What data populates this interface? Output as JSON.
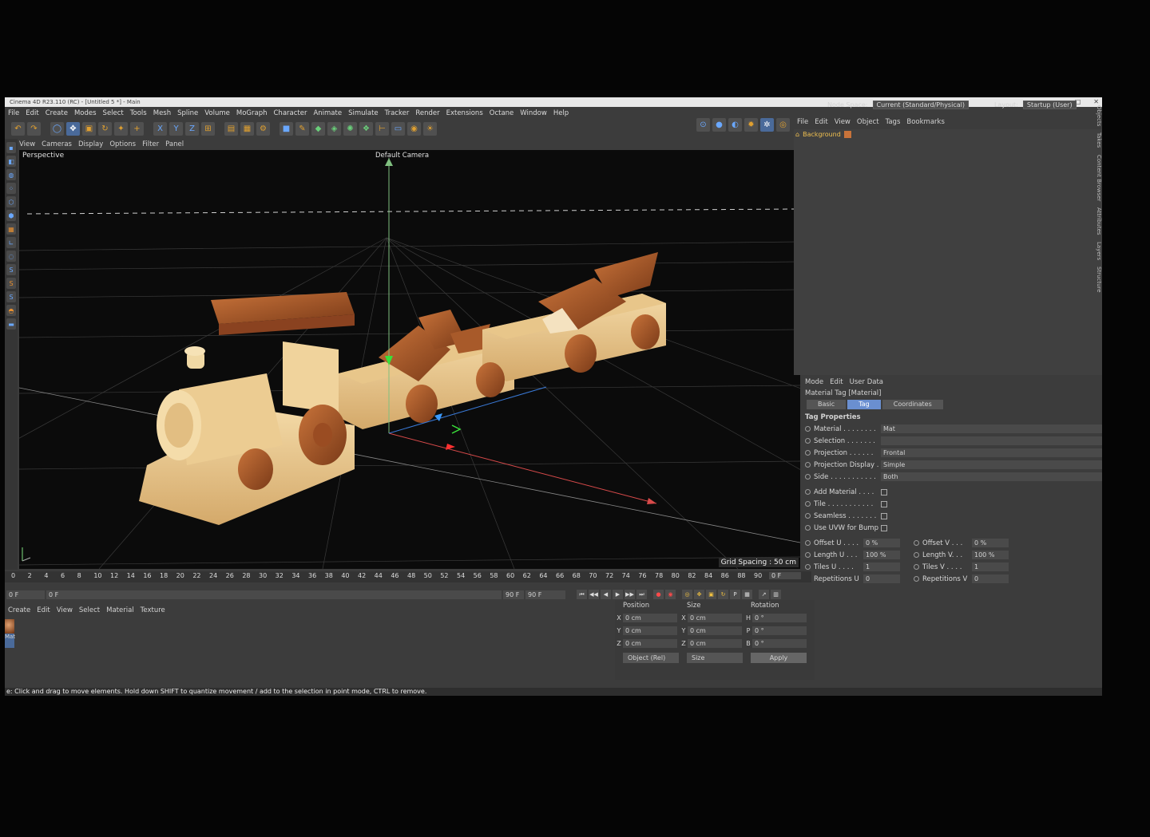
{
  "window": {
    "title": "Cinema 4D R23.110 (RC) - [Untitled 5 *] - Main"
  },
  "menu": [
    "File",
    "Edit",
    "Create",
    "Modes",
    "Select",
    "Tools",
    "Mesh",
    "Spline",
    "Volume",
    "MoGraph",
    "Character",
    "Animate",
    "Simulate",
    "Tracker",
    "Render",
    "Extensions",
    "Octane",
    "Window",
    "Help"
  ],
  "header": {
    "node_space_label": "Node Space:",
    "node_space_value": "Current (Standard/Physical)",
    "layout_label": "Layout:",
    "layout_value": "Startup (User)"
  },
  "viewport": {
    "menu": [
      "View",
      "Cameras",
      "Display",
      "Options",
      "Filter",
      "Panel"
    ],
    "mode": "Perspective",
    "camera": "Default Camera",
    "grid_spacing": "Grid Spacing : 50 cm"
  },
  "objects": {
    "menu": [
      "File",
      "Edit",
      "View",
      "Object",
      "Tags",
      "Bookmarks"
    ],
    "item": "Background"
  },
  "side_tabs": [
    "Objects",
    "Takes",
    "Content Browser",
    "Attributes",
    "Layers",
    "Structure"
  ],
  "attributes": {
    "menu": [
      "Mode",
      "Edit",
      "User Data"
    ],
    "title": "Material Tag [Material]",
    "tabs": [
      "Basic",
      "Tag",
      "Coordinates"
    ],
    "section": "Tag Properties",
    "props": [
      {
        "label": "Material . . . . . . . .",
        "value": "Mat"
      },
      {
        "label": "Selection . . . . . . .",
        "value": ""
      },
      {
        "label": "Projection . . . . . .",
        "value": "Frontal"
      },
      {
        "label": "Projection Display .",
        "value": "Simple"
      },
      {
        "label": "Side . . . . . . . . . . .",
        "value": "Both"
      }
    ],
    "checks": [
      "Add Material . . . .",
      "Tile . . . . . . . . . . .",
      "Seamless . . . . . . .",
      "Use UVW for Bump"
    ],
    "uv": [
      {
        "l1": "Offset U . . . .",
        "v1": "0 %",
        "l2": "Offset V . . .",
        "v2": "0 %"
      },
      {
        "l1": "Length U . . .",
        "v1": "100 %",
        "l2": "Length V. . .",
        "v2": "100 %"
      },
      {
        "l1": "Tiles U . . . .",
        "v1": "1",
        "l2": "Tiles V . . . .",
        "v2": "1"
      },
      {
        "l1": "Repetitions U",
        "v1": "0",
        "l2": "Repetitions V",
        "v2": "0"
      }
    ]
  },
  "timeline": {
    "ticks": [
      "0",
      "2",
      "4",
      "6",
      "8",
      "10",
      "12",
      "14",
      "16",
      "18",
      "20",
      "22",
      "24",
      "26",
      "28",
      "30",
      "32",
      "34",
      "36",
      "38",
      "40",
      "42",
      "44",
      "46",
      "48",
      "50",
      "52",
      "54",
      "56",
      "58",
      "60",
      "62",
      "64",
      "66",
      "68",
      "70",
      "72",
      "74",
      "76",
      "78",
      "80",
      "82",
      "84",
      "86",
      "88",
      "90"
    ],
    "current": "0 F",
    "start": "0 F",
    "end_field": "90 F",
    "end": "90 F",
    "right_field": "0 F"
  },
  "material_menu": [
    "Create",
    "Edit",
    "View",
    "Select",
    "Material",
    "Texture"
  ],
  "material_name": "Mat",
  "coords": {
    "headers": [
      "Position",
      "Size",
      "Rotation"
    ],
    "rows": [
      {
        "a": "X",
        "p": "0 cm",
        "b": "X",
        "s": "0 cm",
        "c": "H",
        "r": "0 °"
      },
      {
        "a": "Y",
        "p": "0 cm",
        "b": "Y",
        "s": "0 cm",
        "c": "P",
        "r": "0 °"
      },
      {
        "a": "Z",
        "p": "0 cm",
        "b": "Z",
        "s": "0 cm",
        "c": "B",
        "r": "0 °"
      }
    ],
    "mode": "Object (Rel)",
    "size_mode": "Size",
    "apply": "Apply"
  },
  "status": "e: Click and drag to move elements. Hold down SHIFT to quantize movement / add to the selection in point mode, CTRL to remove."
}
